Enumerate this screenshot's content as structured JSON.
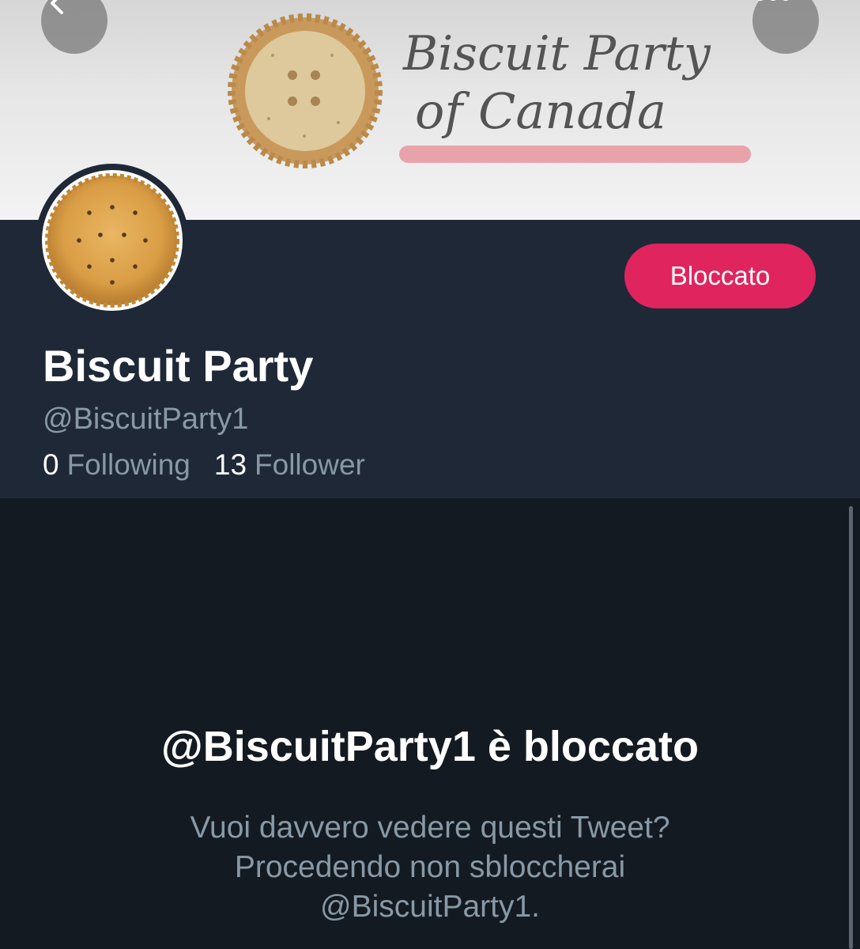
{
  "header": {
    "banner_text_line1": "Biscuit Party",
    "banner_text_line2": "of Canada",
    "back_icon": "chevron-left-icon",
    "more_icon": "more-horizontal-icon"
  },
  "profile": {
    "display_name": "Biscuit Party",
    "handle": "@BiscuitParty1",
    "block_button_label": "Bloccato",
    "following_count": "0",
    "following_label": "Following",
    "followers_count": "13",
    "followers_label": "Follower"
  },
  "blocked_notice": {
    "title": "@BiscuitParty1 è bloccato",
    "message_line1": "Vuoi davvero vedere questi Tweet?",
    "message_line2": "Procedendo non sbloccherai",
    "message_line3": "@BiscuitParty1."
  },
  "colors": {
    "profile_bg": "#1f2837",
    "content_bg": "#141a22",
    "blocked_button": "#e0245e",
    "secondary_text": "#8899a6",
    "banner_underline": "#e8a3aa"
  }
}
